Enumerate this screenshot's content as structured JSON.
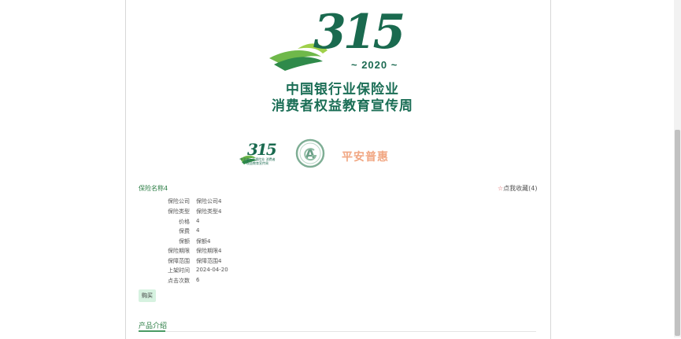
{
  "banner": {
    "logo_number": "315",
    "logo_year": "~ 2020 ~",
    "title_line1": "中国银行业保险业",
    "title_line2": "消费者权益教育宣传周"
  },
  "sponsors": {
    "small_logo_number": "315",
    "small_logo_text": "中国银行业保险业 消费者权益教育宣传周",
    "ag_logo_letters": "AG",
    "pingan_label": "平安普惠"
  },
  "product": {
    "name": "保险名称4",
    "collect_icon": "☆",
    "collect_label": "点我收藏(4)",
    "fields": [
      {
        "label": "保险公司",
        "value": "保险公司4"
      },
      {
        "label": "保险类型",
        "value": "保险类型4"
      },
      {
        "label": "价格",
        "value": "4"
      },
      {
        "label": "保费",
        "value": "4"
      },
      {
        "label": "保额",
        "value": "保额4"
      },
      {
        "label": "保险期限",
        "value": "保险期限4"
      },
      {
        "label": "保障范围",
        "value": "保障范围4"
      },
      {
        "label": "上架时间",
        "value": "2024-04-20"
      },
      {
        "label": "点击次数",
        "value": "6"
      }
    ],
    "buy_label": "购买"
  },
  "tabs": {
    "intro_label": "产品介绍"
  },
  "colors": {
    "brand_green": "#1b6e56",
    "link_green": "#2b7d44",
    "buy_button_bg": "#d6f2e0",
    "pingan_orange": "#f1a783"
  }
}
